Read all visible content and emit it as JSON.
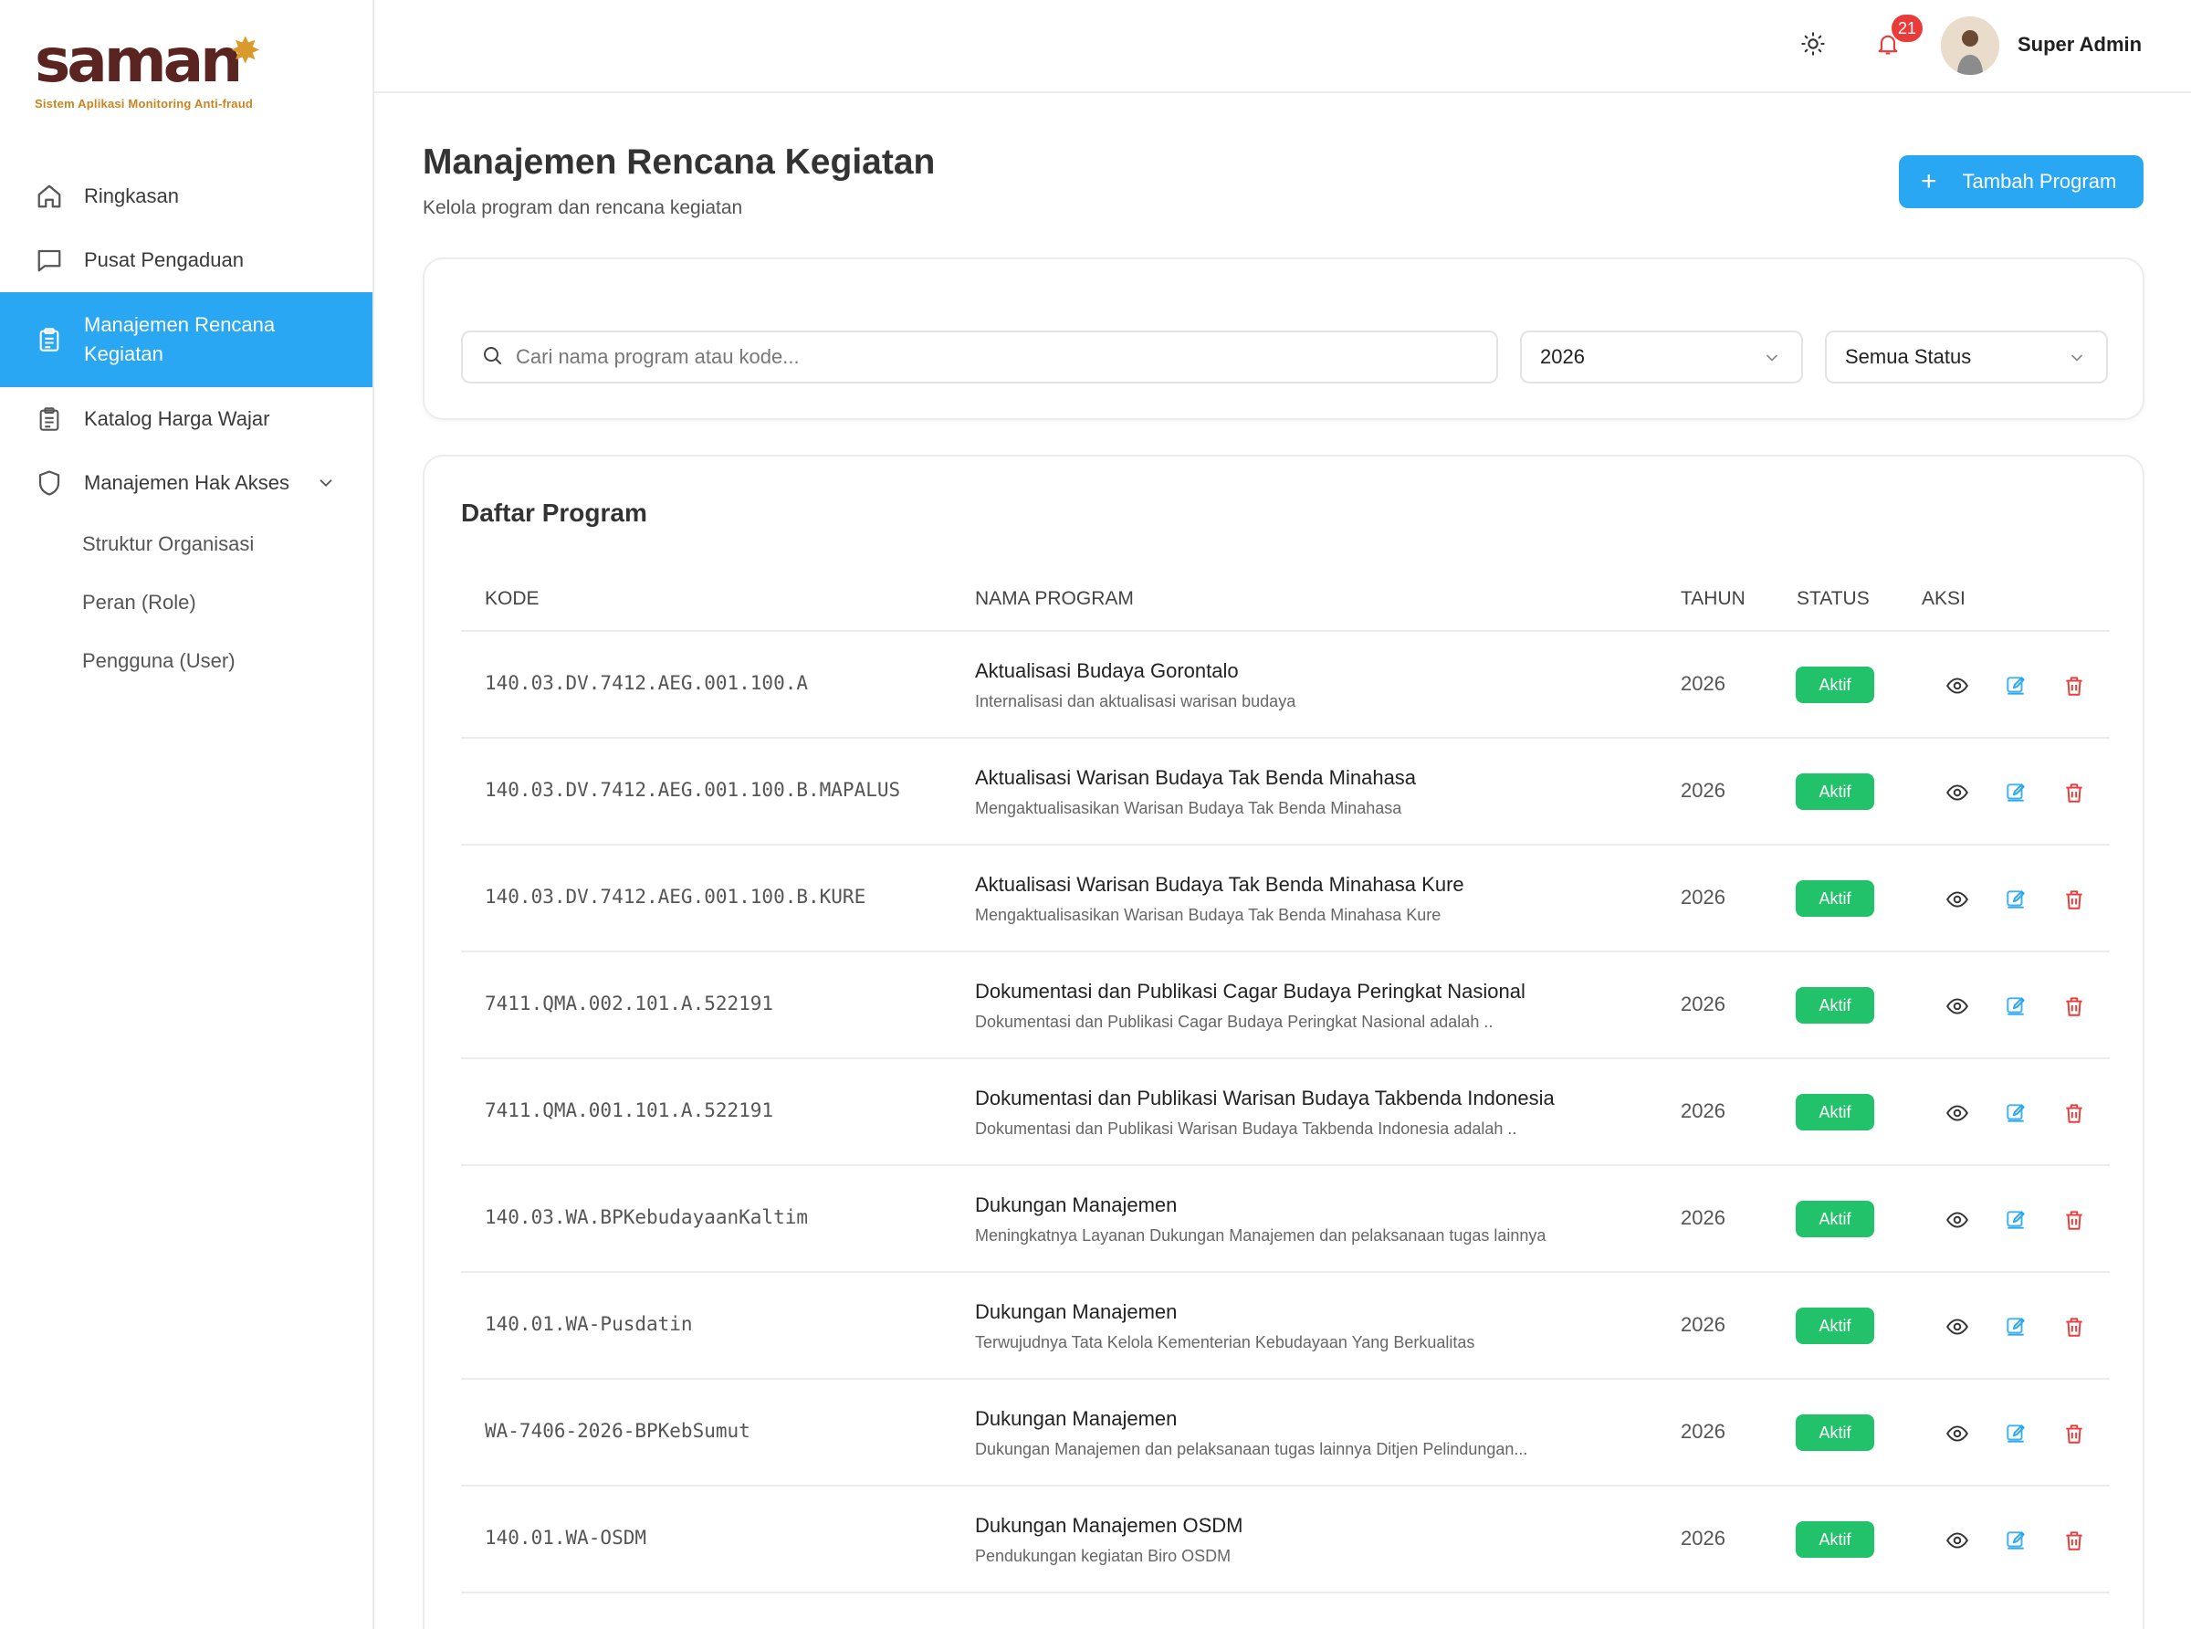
{
  "brand": {
    "name": "saman",
    "tagline": "Sistem Aplikasi Monitoring Anti-fraud"
  },
  "sidebar": {
    "items": [
      {
        "label": "Ringkasan",
        "icon": "home-icon"
      },
      {
        "label": "Pusat Pengaduan",
        "icon": "chat-icon"
      },
      {
        "label": "Manajemen Rencana Kegiatan",
        "icon": "clipboard-icon",
        "active": true
      },
      {
        "label": "Katalog Harga Wajar",
        "icon": "clipboard-icon"
      },
      {
        "label": "Manajemen Hak Akses",
        "icon": "shield-icon",
        "expanded": true
      }
    ],
    "subitems": [
      {
        "label": "Struktur Organisasi"
      },
      {
        "label": "Peran (Role)"
      },
      {
        "label": "Pengguna (User)"
      }
    ]
  },
  "header": {
    "notifications": "21",
    "user_name": "Super Admin"
  },
  "page": {
    "title": "Manajemen Rencana Kegiatan",
    "subtitle": "Kelola program dan rencana kegiatan",
    "add_button": "Tambah Program"
  },
  "filters": {
    "search_placeholder": "Cari nama program atau kode...",
    "year": "2026",
    "status": "Semua Status"
  },
  "table": {
    "title": "Daftar Program",
    "columns": [
      "KODE",
      "NAMA PROGRAM",
      "TAHUN",
      "STATUS",
      "AKSI"
    ],
    "rows": [
      {
        "kode": "140.03.DV.7412.AEG.001.100.A",
        "nama": "Aktualisasi Budaya Gorontalo",
        "deskripsi": "Internalisasi dan aktualisasi warisan budaya",
        "tahun": "2026",
        "status": "Aktif"
      },
      {
        "kode": "140.03.DV.7412.AEG.001.100.B.MAPALUS",
        "nama": "Aktualisasi Warisan Budaya Tak Benda Minahasa",
        "deskripsi": "Mengaktualisasikan Warisan Budaya Tak Benda Minahasa",
        "tahun": "2026",
        "status": "Aktif"
      },
      {
        "kode": "140.03.DV.7412.AEG.001.100.B.KURE",
        "nama": "Aktualisasi Warisan Budaya Tak Benda Minahasa Kure",
        "deskripsi": "Mengaktualisasikan Warisan Budaya Tak Benda Minahasa Kure",
        "tahun": "2026",
        "status": "Aktif"
      },
      {
        "kode": "7411.QMA.002.101.A.522191",
        "nama": "Dokumentasi dan Publikasi Cagar Budaya Peringkat Nasional",
        "deskripsi": "Dokumentasi dan Publikasi Cagar Budaya Peringkat Nasional adalah ..",
        "tahun": "2026",
        "status": "Aktif"
      },
      {
        "kode": "7411.QMA.001.101.A.522191",
        "nama": "Dokumentasi dan Publikasi Warisan Budaya Takbenda Indonesia",
        "deskripsi": "Dokumentasi dan Publikasi Warisan Budaya Takbenda Indonesia adalah ..",
        "tahun": "2026",
        "status": "Aktif"
      },
      {
        "kode": "140.03.WA.BPKebudayaanKaltim",
        "nama": "Dukungan Manajemen",
        "deskripsi": "Meningkatnya Layanan Dukungan Manajemen dan pelaksanaan tugas lainnya",
        "tahun": "2026",
        "status": "Aktif"
      },
      {
        "kode": "140.01.WA-Pusdatin",
        "nama": "Dukungan Manajemen",
        "deskripsi": "Terwujudnya Tata Kelola Kementerian Kebudayaan Yang Berkualitas",
        "tahun": "2026",
        "status": "Aktif"
      },
      {
        "kode": "WA-7406-2026-BPKebSumut",
        "nama": "Dukungan Manajemen",
        "deskripsi": "Dukungan Manajemen dan pelaksanaan tugas lainnya Ditjen Pelindungan...",
        "tahun": "2026",
        "status": "Aktif"
      },
      {
        "kode": "140.01.WA-OSDM",
        "nama": "Dukungan Manajemen OSDM",
        "deskripsi": "Pendukungan kegiatan Biro OSDM",
        "tahun": "2026",
        "status": "Aktif"
      }
    ]
  },
  "colors": {
    "primary": "#29a7f2",
    "success": "#22c26a",
    "danger": "#ea3b3b",
    "brand": "#5a2420",
    "brand_accent": "#d99a2b"
  }
}
